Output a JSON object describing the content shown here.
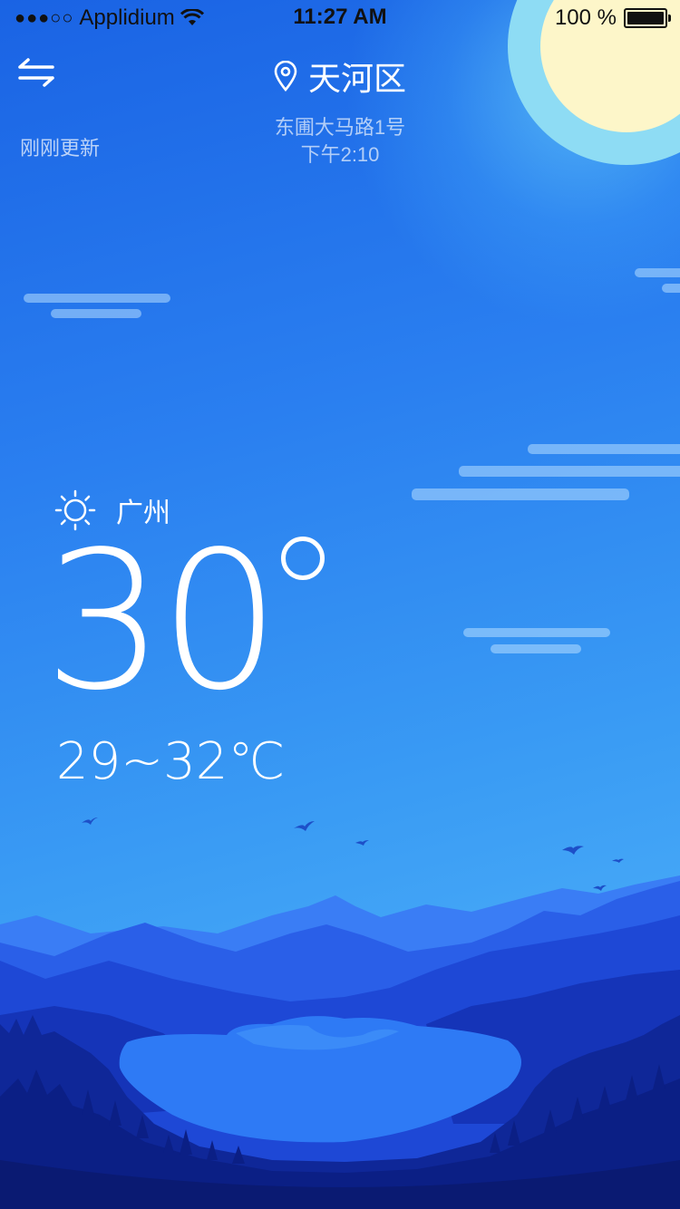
{
  "status_bar": {
    "signal": "●●●○○",
    "carrier": "Applidium",
    "time": "11:27 AM",
    "battery": "100 %"
  },
  "header": {
    "district": "天河区",
    "address": "东圃大马路1号",
    "time": "下午2:10",
    "update_status": "刚刚更新"
  },
  "weather": {
    "icon": "sun-icon",
    "city": "广州",
    "temperature": "30",
    "range": "29~32℃"
  },
  "colors": {
    "sky_top": "#1a63e4",
    "sky_bottom": "#56b9fb",
    "sun": "#fdf6c9",
    "mountain_far": "#2f6ff0",
    "mountain_mid": "#1c49d6",
    "forest": "#0d238c",
    "lake": "#2e7af5"
  }
}
